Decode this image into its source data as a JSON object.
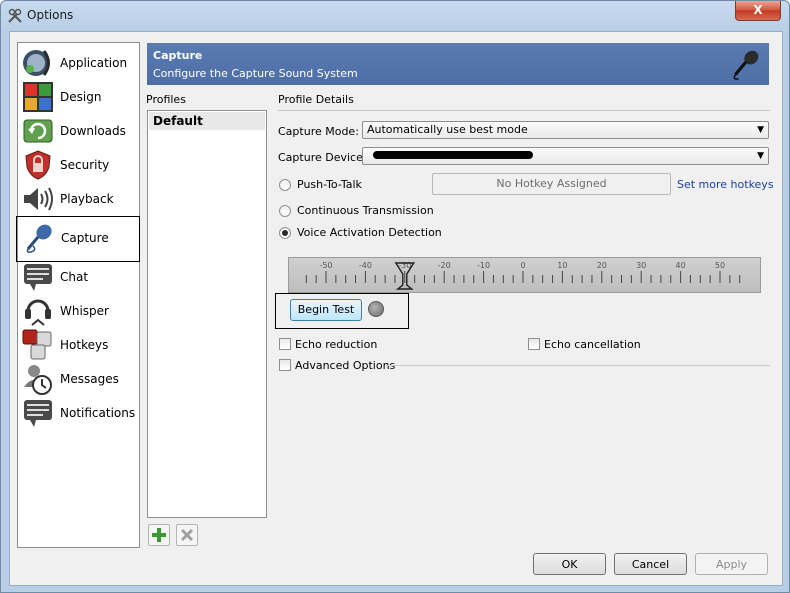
{
  "window": {
    "title": "Options",
    "close_glyph": "X"
  },
  "sidebar": {
    "items": [
      {
        "label": "Application",
        "icon": "application-icon"
      },
      {
        "label": "Design",
        "icon": "design-icon"
      },
      {
        "label": "Downloads",
        "icon": "downloads-icon"
      },
      {
        "label": "Security",
        "icon": "security-icon"
      },
      {
        "label": "Playback",
        "icon": "playback-icon"
      },
      {
        "label": "Capture",
        "icon": "capture-icon",
        "selected": true
      },
      {
        "label": "Chat",
        "icon": "chat-icon"
      },
      {
        "label": "Whisper",
        "icon": "whisper-icon"
      },
      {
        "label": "Hotkeys",
        "icon": "hotkeys-icon"
      },
      {
        "label": "Messages",
        "icon": "messages-icon"
      },
      {
        "label": "Notifications",
        "icon": "notifications-icon"
      }
    ]
  },
  "banner": {
    "title": "Capture",
    "subtitle": "Configure the Capture Sound System",
    "icon": "microphone-icon"
  },
  "profiles": {
    "label": "Profiles",
    "items": [
      "Default"
    ],
    "add_icon": "plus-icon",
    "remove_icon": "x-icon"
  },
  "details": {
    "label": "Profile Details",
    "capture_mode_label": "Capture Mode:",
    "capture_mode_value": "Automatically use best mode",
    "capture_device_label": "Capture Device:",
    "push_to_talk_label": "Push-To-Talk",
    "hotkey_placeholder": "No Hotkey Assigned",
    "set_hotkeys_link": "Set more hotkeys",
    "continuous_label": "Continuous Transmission",
    "vad_label": "Voice Activation Detection",
    "selected_mode": "Voice Activation Detection",
    "meter_ticks": [
      "-50",
      "-40",
      "-30",
      "-20",
      "-10",
      "0",
      "10",
      "20",
      "30",
      "40",
      "50"
    ],
    "meter_threshold": -30,
    "begin_test_label": "Begin Test",
    "echo_reduction_label": "Echo reduction",
    "echo_reduction_checked": false,
    "echo_cancellation_label": "Echo cancellation",
    "echo_cancellation_checked": false,
    "advanced_label": "Advanced Options",
    "advanced_checked": false
  },
  "footer": {
    "ok_label": "OK",
    "cancel_label": "Cancel",
    "apply_label": "Apply"
  }
}
